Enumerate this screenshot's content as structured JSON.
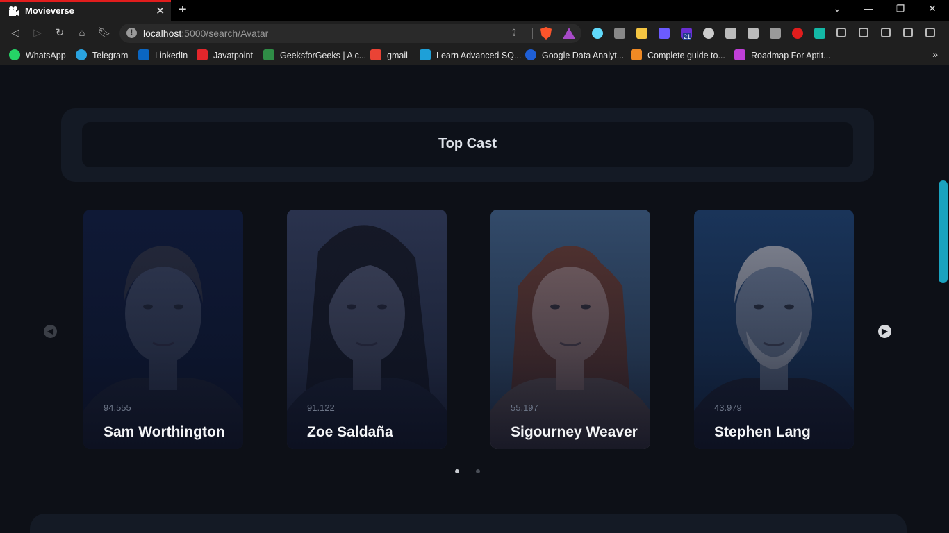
{
  "browser": {
    "tab_title": "Movieverse",
    "url_host": "localhost",
    "url_path": ":5000/search/Avatar",
    "new_tab_label": "+",
    "extensions": [
      "react-devtools-icon",
      "bug-icon",
      "note-icon",
      "grid-icon",
      "calendar-21-icon",
      "glasses-icon",
      "camera-icon",
      "copy-icon",
      "wave-icon",
      "m-red-icon",
      "chat-green-icon",
      "puzzle-icon",
      "playlist-icon",
      "sidebar-icon",
      "wallet-icon",
      "menu-icon"
    ],
    "calendar_badge": "21"
  },
  "bookmarks": [
    {
      "label": "WhatsApp",
      "icon": "whatsapp-icon",
      "color": "#25d366"
    },
    {
      "label": "Telegram",
      "icon": "telegram-icon",
      "color": "#2aa3df"
    },
    {
      "label": "LinkedIn",
      "icon": "linkedin-icon",
      "color": "#0a66c2"
    },
    {
      "label": "Javatpoint",
      "icon": "javatpoint-icon",
      "color": "#e3262b"
    },
    {
      "label": "GeeksforGeeks | A c...",
      "icon": "geeksforgeeks-icon",
      "color": "#2f8d46"
    },
    {
      "label": "gmail",
      "icon": "gmail-icon",
      "color": "#ea4335"
    },
    {
      "label": "Learn Advanced SQ...",
      "icon": "khan-icon",
      "color": "#1ea0d8"
    },
    {
      "label": "Google Data Analyt...",
      "icon": "coursera-icon",
      "color": "#1f5fd6"
    },
    {
      "label": "Complete guide to...",
      "icon": "guide-icon",
      "color": "#f08a24"
    },
    {
      "label": "Roadmap For Aptit...",
      "icon": "roadmap-icon",
      "color": "#c03fd8"
    }
  ],
  "page": {
    "section_title": "Top Cast",
    "cast": [
      {
        "name": "Sam Worthington",
        "popularity": "94.555",
        "tone": "#0c1631"
      },
      {
        "name": "Zoe Saldaña",
        "popularity": "91.122",
        "tone": "#303850"
      },
      {
        "name": "Sigourney Weaver",
        "popularity": "55.197",
        "tone": "#3b5876"
      },
      {
        "name": "Stephen Lang",
        "popularity": "43.979",
        "tone": "#1a3a60"
      }
    ],
    "pagination": {
      "pages": 2,
      "active": 1
    },
    "colors": {
      "accent": "#1aa2bf",
      "panel": "#141a25",
      "background": "#0d1017"
    }
  }
}
